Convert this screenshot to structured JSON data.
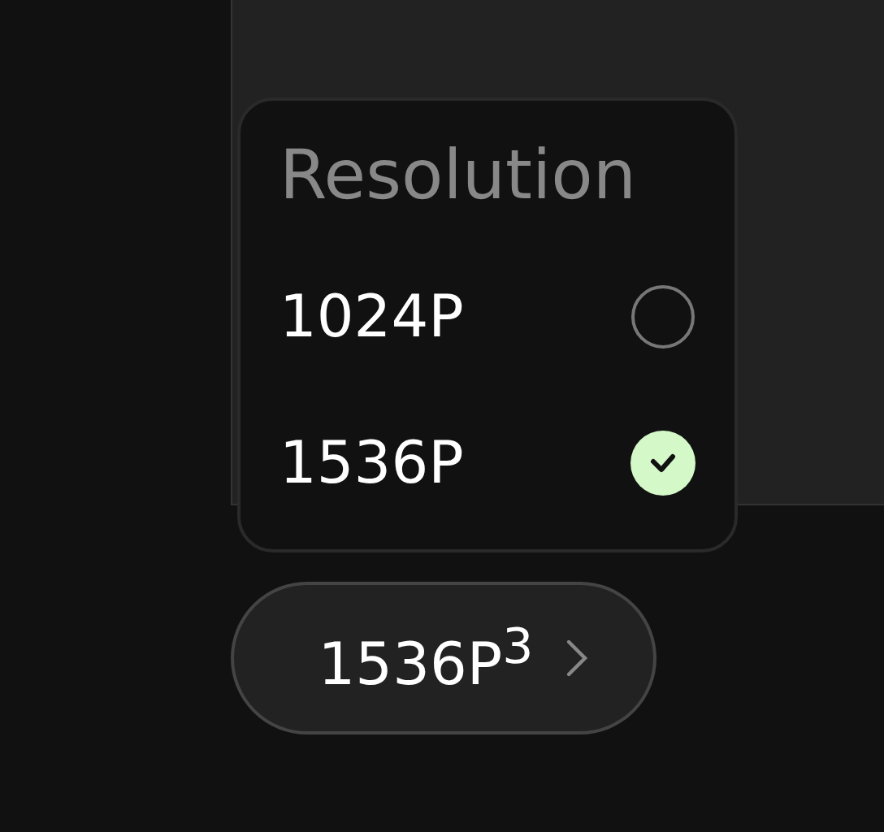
{
  "menu": {
    "title": "Resolution",
    "options": [
      {
        "label": "1024P",
        "selected": false
      },
      {
        "label": "1536P",
        "selected": true
      }
    ]
  },
  "button": {
    "label": "1536P$^{3}$"
  }
}
